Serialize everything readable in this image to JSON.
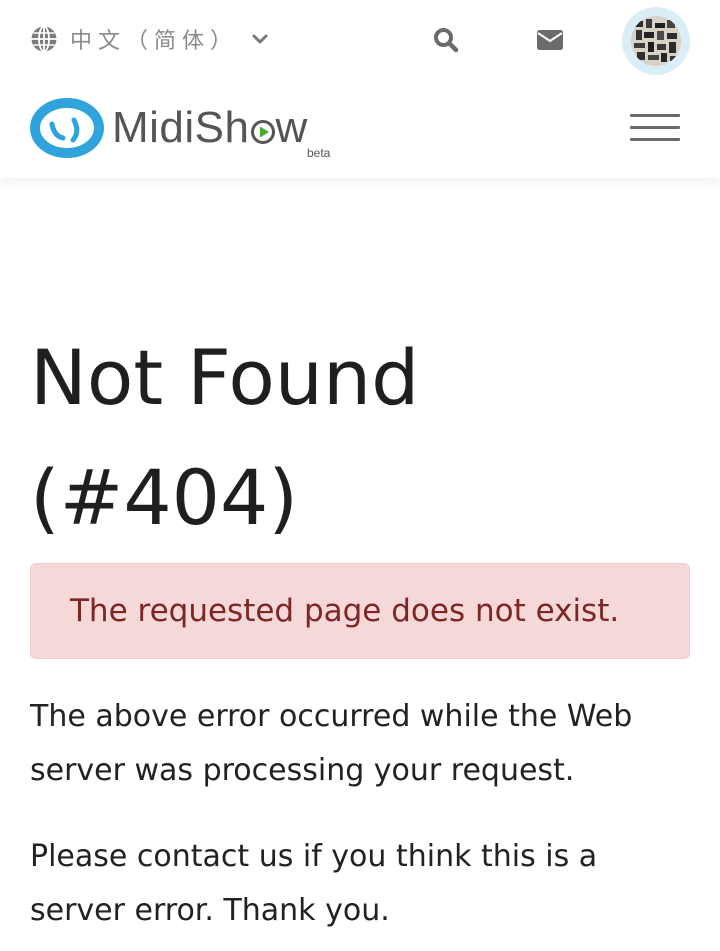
{
  "topbar": {
    "language_label": "中文（简体）",
    "language_icon": "globe-icon",
    "dropdown_icon": "chevron-down-icon",
    "search_icon": "search-icon",
    "mail_icon": "envelope-icon",
    "avatar_icon": "user-avatar"
  },
  "header": {
    "logo_text_left": "MidiSh",
    "logo_text_right": "w",
    "logo_beta": "beta",
    "menu_icon": "hamburger-menu-icon"
  },
  "main": {
    "title_line1": "Not Found",
    "title_line2": "(#404)",
    "alert_message": "The requested page does not exist.",
    "paragraph1": "The above error occurred while the Web server was processing your request.",
    "paragraph2": "Please contact us if you think this is a server error. Thank you."
  },
  "colors": {
    "brand_blue": "#2fa3dc",
    "play_green": "#46b02d",
    "alert_bg": "#f5d9d8",
    "alert_text": "#7d2626"
  }
}
